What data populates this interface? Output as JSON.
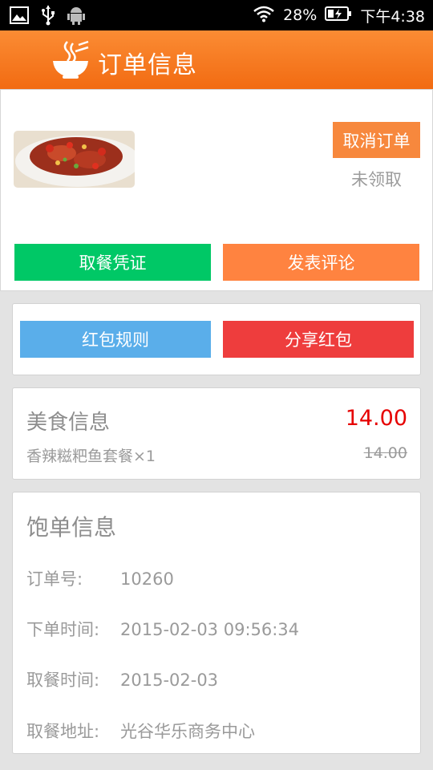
{
  "status_bar": {
    "battery": "28%",
    "time": "下午4:38",
    "icons": [
      "image-icon",
      "usb-icon",
      "android-icon",
      "wifi-icon",
      "battery-charging-icon"
    ]
  },
  "title_bar": {
    "title": "订单信息",
    "logo_icon": "noodle-bowl-icon",
    "bg_color": "#f7771f"
  },
  "order": {
    "cancel_label": "取消订单",
    "status": "未领取",
    "voucher_label": "取餐凭证",
    "review_label": "发表评论",
    "image_name": "spicy-fish-dish-photo"
  },
  "red_packet": {
    "rules_label": "红包规则",
    "share_label": "分享红包"
  },
  "food": {
    "title": "美食信息",
    "price": "14.00",
    "item": "香辣糍粑鱼套餐×1",
    "original_price": "14.00"
  },
  "info": {
    "title": "饱单信息",
    "rows": [
      {
        "label": "订单号:",
        "value": "10260"
      },
      {
        "label": "下单时间:",
        "value": "2015-02-03 09:56:34"
      },
      {
        "label": "取餐时间:",
        "value": "2015-02-03"
      },
      {
        "label": "取餐地址:",
        "value": "光谷华乐商务中心"
      }
    ]
  },
  "colors": {
    "accent_orange": "#f7883d",
    "green": "#00c866",
    "blue": "#5aaeea",
    "red": "#ee3d3d",
    "price_red": "#e60000"
  }
}
